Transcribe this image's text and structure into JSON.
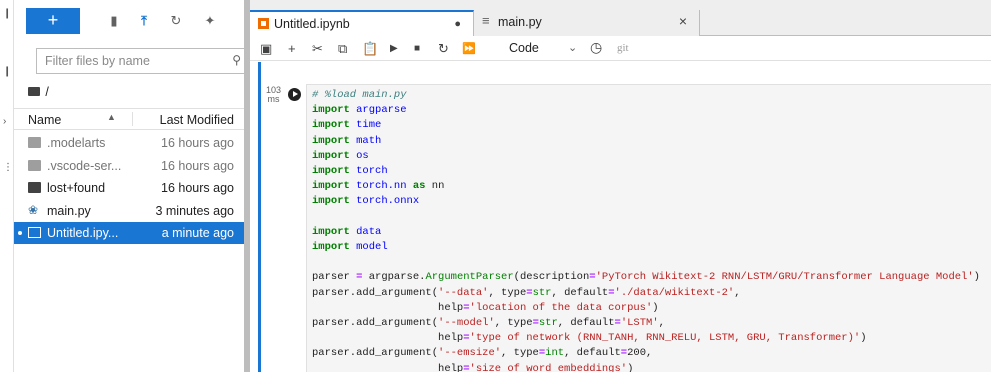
{
  "window": {
    "tabs": [
      {
        "label": "Untitled.ipynb"
      },
      {
        "label": "main.py"
      }
    ]
  },
  "file_browser": {
    "new_label": "+",
    "filter_placeholder": "Filter files by name",
    "breadcrumb": "/",
    "columns": {
      "name": "Name",
      "modified": "Last Modified"
    },
    "files": [
      {
        "name": ".modelarts",
        "modified": "16 hours ago",
        "icon": "folder-icon"
      },
      {
        "name": ".vscode-ser...",
        "modified": "16 hours ago",
        "icon": "folder-icon"
      },
      {
        "name": "lost+found",
        "modified": "16 hours ago",
        "icon": "folder-icon"
      },
      {
        "name": "main.py",
        "modified": "3 minutes ago",
        "icon": "python-icon"
      },
      {
        "name": "Untitled.ipy...",
        "modified": "a minute ago",
        "icon": "notebook-icon"
      }
    ]
  },
  "notebook_toolbar": {
    "cell_type": "Code",
    "kernel_label": "git"
  },
  "cell": {
    "exec_count": "103",
    "exec_unit": "ms",
    "lines": [
      "# %load main.py",
      "import argparse",
      "import time",
      "import math",
      "import os",
      "import torch",
      "import torch.nn as nn",
      "import torch.onnx",
      "",
      "import data",
      "import model",
      "",
      "parser = argparse.ArgumentParser(description='PyTorch Wikitext-2 RNN/LSTM/GRU/Transformer Language Model')",
      "parser.add_argument('--data', type=str, default='./data/wikitext-2',",
      "                    help='location of the data corpus')",
      "parser.add_argument('--model', type=str, default='LSTM',",
      "                    help='type of network (RNN_TANH, RNN_RELU, LSTM, GRU, Transformer)')",
      "parser.add_argument('--emsize', type=int, default=200,",
      "                    help='size of word embeddings')"
    ]
  },
  "colors": {
    "accent": "#1976d2",
    "notebook_icon": "#ef6c00"
  }
}
